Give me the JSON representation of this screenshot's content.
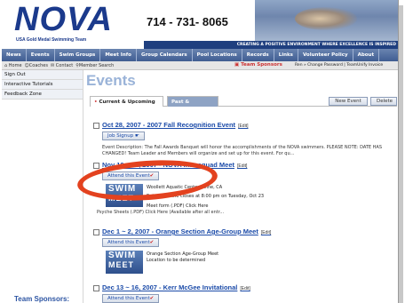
{
  "header": {
    "logo": "NOVA",
    "logo_sub": "USA Gold Medal Swimming Team",
    "phone": "714 - 731- 8065",
    "tagline": "CREATING A POSITIVE ENVIRONMENT WHERE EXCELLENCE IS INSPIRED"
  },
  "nav": {
    "items": [
      "News",
      "Events",
      "Swim Groups",
      "Meet Info",
      "Group Calendars",
      "Pool Locations",
      "Records",
      "Links",
      "Volunteer Policy",
      "About"
    ]
  },
  "subbar": {
    "home": "Home",
    "coaches": "Coaches",
    "contact": "Contact",
    "member_search": "Member Search",
    "sponsors": "Team Sponsors",
    "account": "Ren » Change Password | TeamUnify Invoice"
  },
  "sidebar": {
    "items": [
      "Sign Out",
      "Interactive Tutorials",
      "Feedback Zone"
    ],
    "sponsors_heading": "Team Sponsors:"
  },
  "main": {
    "title": "Events",
    "tabs": {
      "current": "Current & Upcoming",
      "past": "Past & Archived"
    },
    "buttons": {
      "new_event": "New Event",
      "delete": "Delete"
    }
  },
  "events": [
    {
      "title": "Oct 28, 2007 - 2007 Fall Recognition Event",
      "edit": "[Edit]",
      "action": "Job Signup",
      "description": "Event Description: The Fall Awards Banquet will honor the accomplishments of the NOVA swimmers. PLEASE NOTE: DATE HAS CHANGED! Team Leader and Members will organize and set up for this event. For qu..."
    },
    {
      "title": "Nov 10 ~ 11, 2007 - NOVA Intrasquad Meet",
      "edit": "[Edit]",
      "action": "Attend this Event",
      "image": [
        "SWIM",
        "MEET"
      ],
      "lines": [
        "Woollett Aquatic Center Irvine, CA",
        "Entry deadline closes at 8:00 pm on Tuesday, Oct 23",
        "Meet form (.PDF) Click Here"
      ],
      "extra": "Psyche Sheets (.PDF) Click Here (Available after all entr..."
    },
    {
      "title": "Dec 1 ~ 2, 2007 - Orange Section Age-Group Meet",
      "edit": "[Edit]",
      "action": "Attend this Event",
      "image": [
        "SWIM",
        "MEET"
      ],
      "lines": [
        "Orange Section Age-Group Meet",
        "Location to be determined"
      ]
    },
    {
      "title": "Dec 13 ~ 16, 2007 - Kerr McGee Invitational",
      "edit": "[Edit]",
      "action": "Attend this Event"
    }
  ],
  "colors": {
    "nav": "#3f5d92",
    "link": "#1a4aa8",
    "annotation": "#e3421f"
  }
}
